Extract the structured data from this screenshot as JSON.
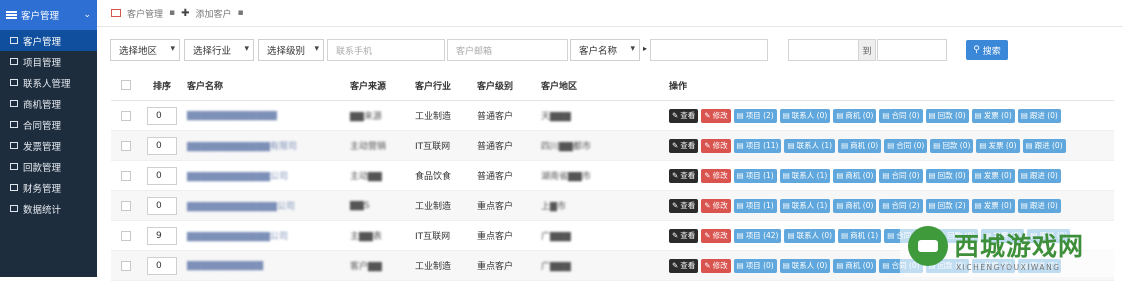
{
  "sidebar": {
    "header": "客户管理",
    "items": [
      {
        "label": "客户管理"
      },
      {
        "label": "项目管理"
      },
      {
        "label": "联系人管理"
      },
      {
        "label": "商机管理"
      },
      {
        "label": "合同管理"
      },
      {
        "label": "发票管理"
      },
      {
        "label": "回款管理"
      },
      {
        "label": "财务管理"
      },
      {
        "label": "数据统计"
      }
    ]
  },
  "breadcrumb": {
    "home": "客户管理",
    "current": "添加客户"
  },
  "filters": {
    "region": "选择地区",
    "industry": "选择行业",
    "level": "选择级别",
    "phone_placeholder": "联系手机",
    "email_placeholder": "客户邮箱",
    "field": "客户名称",
    "range_to": "到",
    "search_label": "搜索"
  },
  "table": {
    "headers": [
      "排序",
      "客户名称",
      "客户来源",
      "客户行业",
      "客户级别",
      "客户地区",
      "操作"
    ],
    "rows": [
      {
        "sort": "0",
        "name": "▇▇▇▇▇▇▇▇▇▇▇▇▇",
        "source": "▇▇来源",
        "industry": "工业制造",
        "level": "普通客户",
        "region": "天▇▇▇",
        "actions": [
          "查看",
          "修改",
          "项目 (2)",
          "联系人 (0)",
          "商机 (0)",
          "合同 (0)",
          "回款 (0)",
          "发票 (0)",
          "跟进 (0)"
        ]
      },
      {
        "sort": "0",
        "name": "▇▇▇▇▇▇▇▇▇▇▇▇有限司",
        "source": "主动营销",
        "industry": "IT互联网",
        "level": "普通客户",
        "region": "四川▇▇都市",
        "actions": [
          "查看",
          "修改",
          "项目 (11)",
          "联系人 (1)",
          "商机 (0)",
          "合同 (0)",
          "回款 (0)",
          "发票 (0)",
          "跟进 (0)"
        ]
      },
      {
        "sort": "0",
        "name": "▇▇▇▇▇▇▇▇▇▇▇▇公司",
        "source": "主动▇▇",
        "industry": "食品饮食",
        "level": "普通客户",
        "region": "湖南省▇▇市",
        "actions": [
          "查看",
          "修改",
          "项目 (1)",
          "联系人 (1)",
          "商机 (0)",
          "合同 (0)",
          "回款 (0)",
          "发票 (0)",
          "跟进 (0)"
        ]
      },
      {
        "sort": "0",
        "name": "▇▇▇▇▇▇▇▇▇▇▇▇▇公司",
        "source": "▇▇S",
        "industry": "工业制造",
        "level": "重点客户",
        "region": "上▇市",
        "actions": [
          "查看",
          "修改",
          "项目 (1)",
          "联系人 (1)",
          "商机 (0)",
          "合同 (2)",
          "回款 (2)",
          "发票 (0)",
          "跟进 (0)"
        ]
      },
      {
        "sort": "9",
        "name": "▇▇▇▇▇▇▇▇▇▇▇▇公司",
        "source": "主▇▇表",
        "industry": "IT互联网",
        "level": "重点客户",
        "region": "广▇▇▇",
        "actions": [
          "查看",
          "修改",
          "项目 (42)",
          "联系人 (0)",
          "商机 (1)",
          "合同 (22)",
          "回款 (0)",
          "发票 (0)",
          "跟进 (0)"
        ]
      },
      {
        "sort": "0",
        "name": "▇▇▇▇▇▇▇▇▇▇▇",
        "source": "客户▇▇",
        "industry": "工业制造",
        "level": "重点客户",
        "region": "广▇▇▇",
        "actions": [
          "查看",
          "修改",
          "项目 (0)",
          "联系人 (0)",
          "商机 (0)",
          "合同 (0)",
          "回款 (0)",
          "发票 (0)",
          "跟进 (0)"
        ]
      }
    ]
  },
  "watermark": {
    "title": "西城游戏网",
    "subtitle": "XICHENGYOUXIWANG"
  },
  "colors": {
    "sidebar": "#1e2d3d",
    "sidebar_header": "#2d6fd3",
    "primary": "#3b87d8",
    "danger": "#d9534f",
    "info": "#5fa7dc"
  }
}
